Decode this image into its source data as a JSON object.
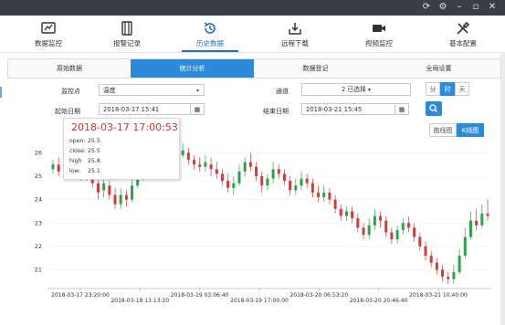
{
  "titlebar": {
    "icons": [
      "refresh-icon",
      "gear-icon",
      "minimize-icon",
      "restore-icon",
      "close-icon"
    ]
  },
  "nav": {
    "items": [
      {
        "label": "数据监控",
        "icon": "monitor-icon"
      },
      {
        "label": "报警记录",
        "icon": "alarm-log-icon"
      },
      {
        "label": "历史数据",
        "icon": "history-icon"
      },
      {
        "label": "远程下载",
        "icon": "download-icon"
      },
      {
        "label": "视频监控",
        "icon": "video-icon"
      },
      {
        "label": "基本配置",
        "icon": "tools-icon"
      }
    ],
    "active_index": 2
  },
  "subtabs": {
    "items": [
      "原始数据",
      "统计分析",
      "数据登记",
      "全局设置"
    ],
    "active_index": 1
  },
  "form": {
    "point_label": "监控点",
    "point_value": "温度",
    "channel_label": "通道",
    "channel_value": "2 已选择",
    "start_label": "起始日期",
    "start_value": "2018-03-17 15:41",
    "end_label": "结束日期",
    "end_value": "2018-03-21 15:45",
    "granularity": [
      "分",
      "时",
      "天"
    ],
    "granularity_active": 1,
    "view_modes": [
      "曲线图",
      "K线图"
    ],
    "view_active": 1
  },
  "tooltip": {
    "date": "2018-03-17 17:00:53",
    "rows": [
      {
        "key": "open:",
        "value": "25.5"
      },
      {
        "key": "close:",
        "value": "25.5"
      },
      {
        "key": "high",
        "value": "25.8"
      },
      {
        "key": "low:",
        "value": "25.1"
      }
    ]
  },
  "chart_data": {
    "type": "candlestick",
    "ylim": [
      20.2,
      26.6
    ],
    "y_ticks": [
      "26",
      "25",
      "24",
      "23",
      "22",
      "21"
    ],
    "x_ticks": [
      "2018-03-17 23:20:00",
      "2018-03-18 13:13:20",
      "2018-03-19 03:06:40",
      "2018-03-19 17:00:00",
      "2018-03-20 06:53:20",
      "2018-03-20 20:46:40",
      "2018-03-21 10:40:00"
    ],
    "up_color": "#2aa44a",
    "down_color": "#d73a3a",
    "candles": [
      [
        25.3,
        25.5,
        25.7,
        25.1
      ],
      [
        25.5,
        25.2,
        25.8,
        25.0
      ],
      [
        25.4,
        25.6,
        25.8,
        25.2
      ],
      [
        25.5,
        25.5,
        25.8,
        25.1
      ],
      [
        25.6,
        25.3,
        25.9,
        25.0
      ],
      [
        25.4,
        25.0,
        25.7,
        24.8
      ],
      [
        25.0,
        25.3,
        25.6,
        24.8
      ],
      [
        25.2,
        24.7,
        25.4,
        24.5
      ],
      [
        24.7,
        24.3,
        24.9,
        24.0
      ],
      [
        24.4,
        24.7,
        24.9,
        24.1
      ],
      [
        24.6,
        24.2,
        24.8,
        24.0
      ],
      [
        24.2,
        23.8,
        24.5,
        23.6
      ],
      [
        23.8,
        24.2,
        24.5,
        23.6
      ],
      [
        24.2,
        24.0,
        24.4,
        23.7
      ],
      [
        24.0,
        24.6,
        25.0,
        23.9
      ],
      [
        24.6,
        24.9,
        25.2,
        24.5
      ],
      [
        24.9,
        25.1,
        25.4,
        24.8
      ],
      [
        25.1,
        25.3,
        25.6,
        25.0
      ],
      [
        25.3,
        25.5,
        25.7,
        25.1
      ],
      [
        25.5,
        25.6,
        25.8,
        25.3
      ],
      [
        25.6,
        25.8,
        26.1,
        25.4
      ],
      [
        25.8,
        25.6,
        26.0,
        25.4
      ],
      [
        25.6,
        25.9,
        26.3,
        25.5
      ],
      [
        25.9,
        26.1,
        26.4,
        25.8
      ],
      [
        26.0,
        25.7,
        26.2,
        25.5
      ],
      [
        25.7,
        25.5,
        25.9,
        25.3
      ],
      [
        25.5,
        25.4,
        25.8,
        25.2
      ],
      [
        25.4,
        25.6,
        25.9,
        25.2
      ],
      [
        25.5,
        25.3,
        25.8,
        25.0
      ],
      [
        25.3,
        25.1,
        25.6,
        24.9
      ],
      [
        25.1,
        24.8,
        25.3,
        24.6
      ],
      [
        24.8,
        24.5,
        25.1,
        24.3
      ],
      [
        24.5,
        24.7,
        25.0,
        24.2
      ],
      [
        24.7,
        25.2,
        25.5,
        24.6
      ],
      [
        25.2,
        25.6,
        25.8,
        25.0
      ],
      [
        25.6,
        25.4,
        26.0,
        25.2
      ],
      [
        25.4,
        25.0,
        25.6,
        24.8
      ],
      [
        25.0,
        24.6,
        25.2,
        24.3
      ],
      [
        24.6,
        24.9,
        25.1,
        24.4
      ],
      [
        24.9,
        25.3,
        25.6,
        24.7
      ],
      [
        25.3,
        25.1,
        25.5,
        24.9
      ],
      [
        25.1,
        24.8,
        25.3,
        24.6
      ],
      [
        24.8,
        24.4,
        25.0,
        24.2
      ],
      [
        24.4,
        24.6,
        24.9,
        24.2
      ],
      [
        24.6,
        24.9,
        25.2,
        24.4
      ],
      [
        24.9,
        24.7,
        25.1,
        24.5
      ],
      [
        24.7,
        24.3,
        24.9,
        24.1
      ],
      [
        24.3,
        24.1,
        24.6,
        23.9
      ],
      [
        24.1,
        24.3,
        24.6,
        23.9
      ],
      [
        24.3,
        24.0,
        24.5,
        23.8
      ],
      [
        24.0,
        23.6,
        24.2,
        23.4
      ],
      [
        23.6,
        23.3,
        23.8,
        23.1
      ],
      [
        23.3,
        23.5,
        23.7,
        23.1
      ],
      [
        23.5,
        23.2,
        23.7,
        23.0
      ],
      [
        23.2,
        22.8,
        23.4,
        22.6
      ],
      [
        22.8,
        22.5,
        23.0,
        22.3
      ],
      [
        22.5,
        22.9,
        23.2,
        22.3
      ],
      [
        22.9,
        23.3,
        23.6,
        22.7
      ],
      [
        23.3,
        23.1,
        23.5,
        22.8
      ],
      [
        23.1,
        22.6,
        23.3,
        22.4
      ],
      [
        22.6,
        22.3,
        22.8,
        22.1
      ],
      [
        22.3,
        22.7,
        22.9,
        22.1
      ],
      [
        22.7,
        23.0,
        23.2,
        22.5
      ],
      [
        23.0,
        22.8,
        23.3,
        22.6
      ],
      [
        22.8,
        22.4,
        23.0,
        22.2
      ],
      [
        22.4,
        22.0,
        22.6,
        21.8
      ],
      [
        22.0,
        21.6,
        22.2,
        21.4
      ],
      [
        21.6,
        21.3,
        21.8,
        21.1
      ],
      [
        21.3,
        21.0,
        21.5,
        20.8
      ],
      [
        21.0,
        20.7,
        21.2,
        20.5
      ],
      [
        20.7,
        20.6,
        20.9,
        20.4
      ],
      [
        20.6,
        20.9,
        21.2,
        20.4
      ],
      [
        20.9,
        21.6,
        21.9,
        20.8
      ],
      [
        21.6,
        22.4,
        22.8,
        21.5
      ],
      [
        22.4,
        23.1,
        23.5,
        22.3
      ],
      [
        23.1,
        22.9,
        23.6,
        22.7
      ],
      [
        22.9,
        23.4,
        23.8,
        22.8
      ],
      [
        23.4,
        23.3,
        24.0,
        23.1
      ]
    ]
  }
}
